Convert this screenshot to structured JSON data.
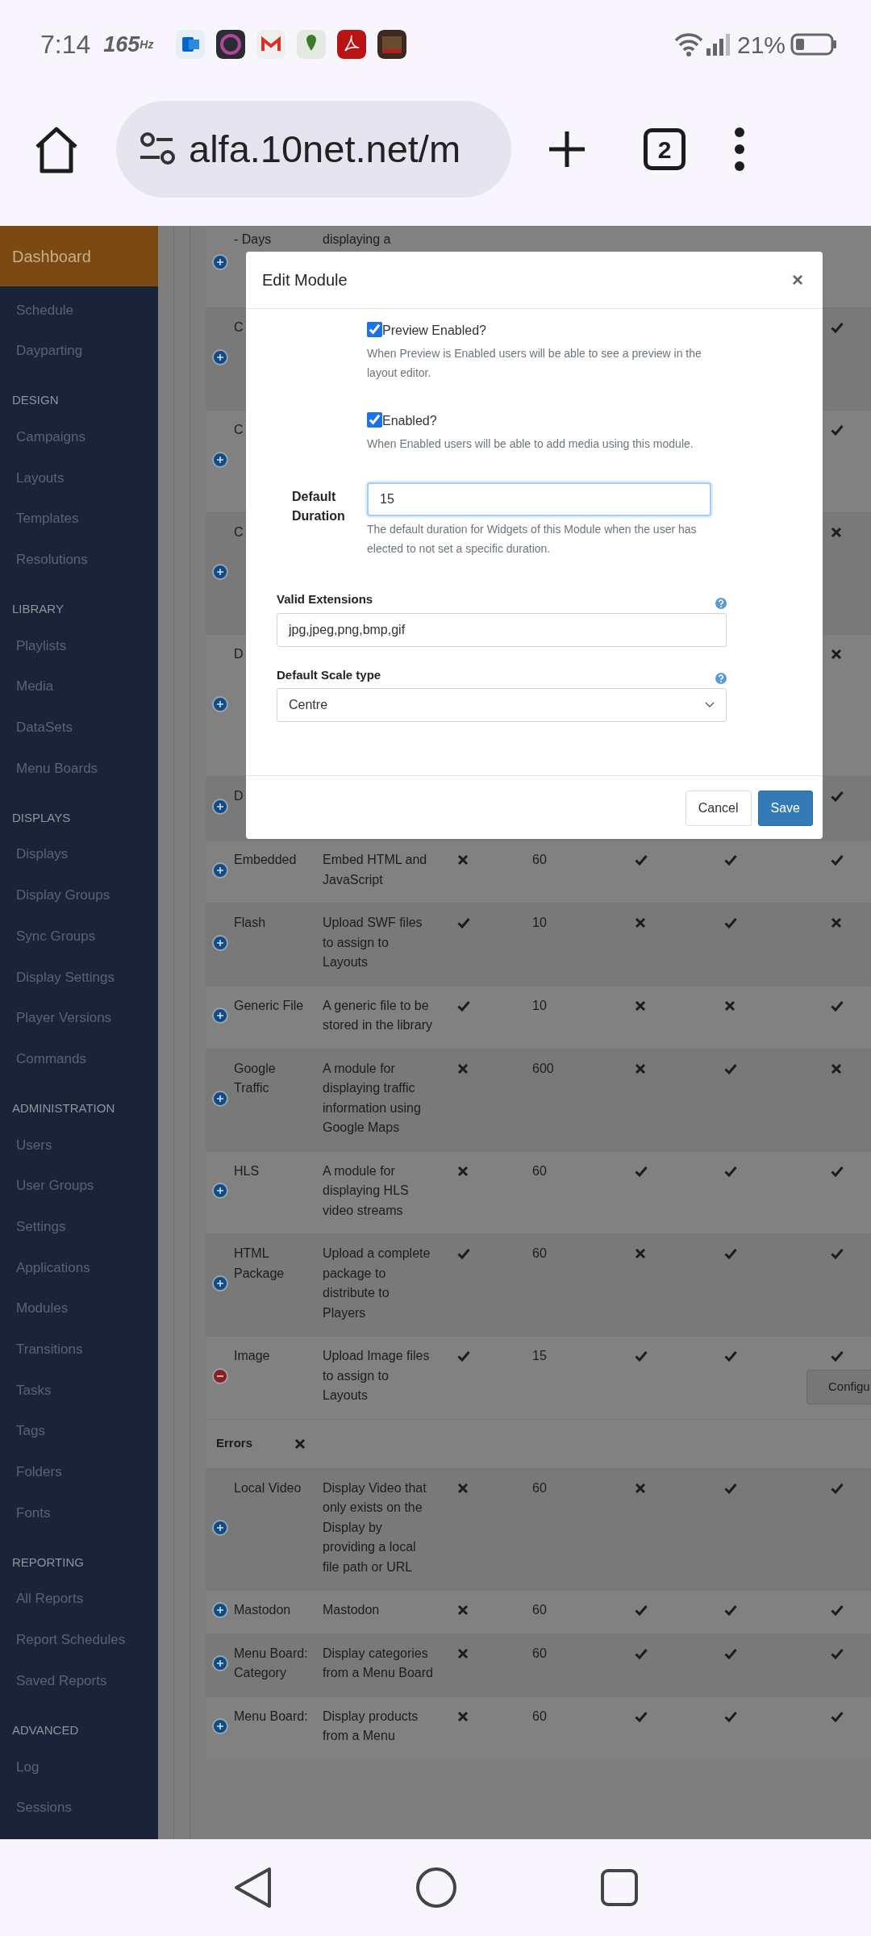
{
  "status_bar": {
    "time": "7:14",
    "refresh_rate": "165",
    "refresh_unit": "Hz",
    "battery": "21%"
  },
  "browser": {
    "url": "alfa.10net.net/m",
    "tab_count": "2"
  },
  "sidebar": {
    "items": [
      {
        "kind": "link",
        "label": "Dashboard",
        "selected": true
      },
      {
        "kind": "link",
        "label": "Schedule",
        "selected": false
      },
      {
        "kind": "link",
        "label": "Dayparting",
        "selected": false
      },
      {
        "kind": "header",
        "label": "DESIGN"
      },
      {
        "kind": "link",
        "label": "Campaigns",
        "selected": false
      },
      {
        "kind": "link",
        "label": "Layouts",
        "selected": false
      },
      {
        "kind": "link",
        "label": "Templates",
        "selected": false
      },
      {
        "kind": "link",
        "label": "Resolutions",
        "selected": false
      },
      {
        "kind": "header",
        "label": "LIBRARY"
      },
      {
        "kind": "link",
        "label": "Playlists",
        "selected": false
      },
      {
        "kind": "link",
        "label": "Media",
        "selected": false
      },
      {
        "kind": "link",
        "label": "DataSets",
        "selected": false
      },
      {
        "kind": "link",
        "label": "Menu Boards",
        "selected": false
      },
      {
        "kind": "header",
        "label": "DISPLAYS"
      },
      {
        "kind": "link",
        "label": "Displays",
        "selected": false
      },
      {
        "kind": "link",
        "label": "Display Groups",
        "selected": false
      },
      {
        "kind": "link",
        "label": "Sync Groups",
        "selected": false
      },
      {
        "kind": "link",
        "label": "Display Settings",
        "selected": false
      },
      {
        "kind": "link",
        "label": "Player Versions",
        "selected": false
      },
      {
        "kind": "link",
        "label": "Commands",
        "selected": false
      },
      {
        "kind": "header",
        "label": "ADMINISTRATION"
      },
      {
        "kind": "link",
        "label": "Users",
        "selected": false
      },
      {
        "kind": "link",
        "label": "User Groups",
        "selected": false
      },
      {
        "kind": "link",
        "label": "Settings",
        "selected": false
      },
      {
        "kind": "link",
        "label": "Applications",
        "selected": false
      },
      {
        "kind": "link",
        "label": "Modules",
        "selected": false
      },
      {
        "kind": "link",
        "label": "Transitions",
        "selected": false
      },
      {
        "kind": "link",
        "label": "Tasks",
        "selected": false
      },
      {
        "kind": "link",
        "label": "Tags",
        "selected": false
      },
      {
        "kind": "link",
        "label": "Folders",
        "selected": false
      },
      {
        "kind": "link",
        "label": "Fonts",
        "selected": false
      },
      {
        "kind": "header",
        "label": "REPORTING"
      },
      {
        "kind": "link",
        "label": "All Reports",
        "selected": false
      },
      {
        "kind": "link",
        "label": "Report Schedules",
        "selected": false
      },
      {
        "kind": "link",
        "label": "Saved Reports",
        "selected": false
      },
      {
        "kind": "header",
        "label": "ADVANCED"
      },
      {
        "kind": "link",
        "label": "Log",
        "selected": false
      },
      {
        "kind": "link",
        "label": "Sessions",
        "selected": false
      }
    ]
  },
  "table": {
    "rows": [
      {
        "kind": "module",
        "expanded": false,
        "name": "- Days",
        "description": "displaying a"
      },
      {
        "kind": "module",
        "expanded": false,
        "name": "C",
        "column_7": true
      },
      {
        "kind": "module",
        "expanded": false,
        "name": "C",
        "column_7": true
      },
      {
        "kind": "module",
        "expanded": false,
        "name": "C",
        "column_7": false
      },
      {
        "kind": "module",
        "expanded": false,
        "name": "D",
        "column_7": false
      },
      {
        "kind": "module",
        "expanded": false,
        "name": "D",
        "column_7": true
      },
      {
        "kind": "module",
        "expanded": false,
        "name": "Embedded",
        "description": "Embed HTML and JavaScript",
        "column_3": false,
        "column_4": "60",
        "column_5": true,
        "column_6": true,
        "column_7": true
      },
      {
        "kind": "module",
        "expanded": false,
        "name": "Flash",
        "description": "Upload SWF files to assign to Layouts",
        "column_3": true,
        "column_4": "10",
        "column_5": false,
        "column_6": true,
        "column_7": false
      },
      {
        "kind": "module",
        "expanded": false,
        "name": "Generic File",
        "description": "A generic file to be stored in the library",
        "column_3": true,
        "column_4": "10",
        "column_5": false,
        "column_6": false,
        "column_7": true
      },
      {
        "kind": "module",
        "expanded": false,
        "name": "Google Traffic",
        "description": "A module for displaying traffic information using Google Maps",
        "column_3": false,
        "column_4": "600",
        "column_5": false,
        "column_6": true,
        "column_7": false
      },
      {
        "kind": "module",
        "expanded": false,
        "name": "HLS",
        "description": "A module for displaying HLS video streams",
        "column_3": false,
        "column_4": "60",
        "column_5": true,
        "column_6": true,
        "column_7": true
      },
      {
        "kind": "module",
        "expanded": false,
        "name": "HTML Package",
        "description": "Upload a complete package to distribute to Players",
        "column_3": true,
        "column_4": "60",
        "column_5": false,
        "column_6": true,
        "column_7": true
      },
      {
        "kind": "module",
        "expanded": true,
        "name": "Image",
        "description": "Upload Image files to assign to Layouts",
        "column_3": true,
        "column_4": "15",
        "column_5": true,
        "column_6": true,
        "column_7": true,
        "button": "Configu"
      },
      {
        "kind": "group",
        "name": "Errors"
      },
      {
        "kind": "module",
        "expanded": false,
        "name": "Local Video",
        "description": "Display Video that only exists on the Display by providing a local file path or URL",
        "column_3": false,
        "column_4": "60",
        "column_5": false,
        "column_6": true,
        "column_7": true
      },
      {
        "kind": "module",
        "expanded": false,
        "name": "Mastodon",
        "description": "Mastodon",
        "column_3": false,
        "column_4": "60",
        "column_5": true,
        "column_6": true,
        "column_7": true
      },
      {
        "kind": "module",
        "expanded": false,
        "name": "Menu Board: Category",
        "description": "Display categories from a Menu Board",
        "column_3": false,
        "column_4": "60",
        "column_5": true,
        "column_6": true,
        "column_7": true
      },
      {
        "kind": "module",
        "expanded": false,
        "name": "Menu Board:",
        "description": "Display products from a Menu",
        "column_3": false,
        "column_4": "60",
        "column_5": true,
        "column_6": true,
        "column_7": true
      }
    ]
  },
  "modal": {
    "title": "Edit Module",
    "close": "×",
    "checkboxes": [
      {
        "label": "Preview Enabled?",
        "checked": true,
        "help": "When Preview is Enabled users will be able to see a preview in the layout editor."
      },
      {
        "label": "Enabled?",
        "checked": true,
        "help": "When Enabled users will be able to add media using this module."
      }
    ],
    "duration": {
      "label": "Default Duration",
      "value": "15",
      "help": "The default duration for Widgets of this Module when the user has elected to not set a specific duration."
    },
    "fields": [
      {
        "kind": "text",
        "label": "Valid Extensions",
        "value": "jpg,jpeg,png,bmp,gif"
      },
      {
        "kind": "select",
        "label": "Default Scale type",
        "value": "Centre"
      }
    ],
    "buttons": [
      {
        "kind": "secondary",
        "label": "Cancel"
      },
      {
        "kind": "primary",
        "label": "Save"
      }
    ]
  }
}
